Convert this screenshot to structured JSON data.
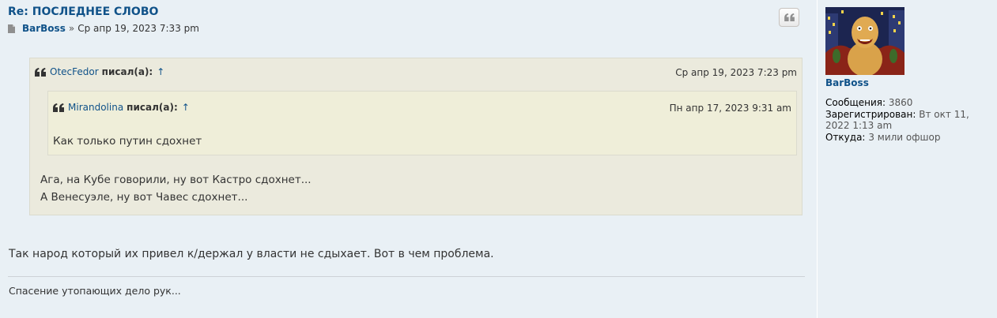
{
  "post": {
    "title": "Re: ПОСЛЕДНЕЕ СЛОВО",
    "author": "BarBoss",
    "separator": "»",
    "date": "Ср апр 19, 2023 7:33 pm",
    "main_text": "Так народ который их привел к/держал у власти не сдыхает. Вот в чем проблема.",
    "signature": "Спасение утопающих дело рук..."
  },
  "outer_quote": {
    "author": "OtecFedor",
    "wrote": "писал(а):",
    "up_arrow": "↑",
    "date": "Ср апр 19, 2023 7:23 pm",
    "lines": [
      "Ага, на Кубе говорили, ну вот Кастро сдохнет...",
      "А Венесуэле, ну вот Чавес сдохнет..."
    ]
  },
  "inner_quote": {
    "author": "Mirandolina",
    "wrote": "писал(а):",
    "up_arrow": "↑",
    "date": "Пн апр 17, 2023 9:31 am",
    "text": "Как только путин сдохнет"
  },
  "profile": {
    "username": "BarBoss",
    "posts_label": "Сообщения:",
    "posts_value": "3860",
    "registered_label": "Зарегистрирован:",
    "registered_value": "Вт окт 11, 2022 1:13 am",
    "location_label": "Откуда:",
    "location_value": "3 мили офшор"
  },
  "colors": {
    "link": "#105289",
    "background": "#e9f0f5",
    "quote_outer": "#ebeadd",
    "quote_inner": "#efeed9"
  },
  "icons": [
    "file-icon",
    "quote-icon",
    "quote-button-icon"
  ]
}
